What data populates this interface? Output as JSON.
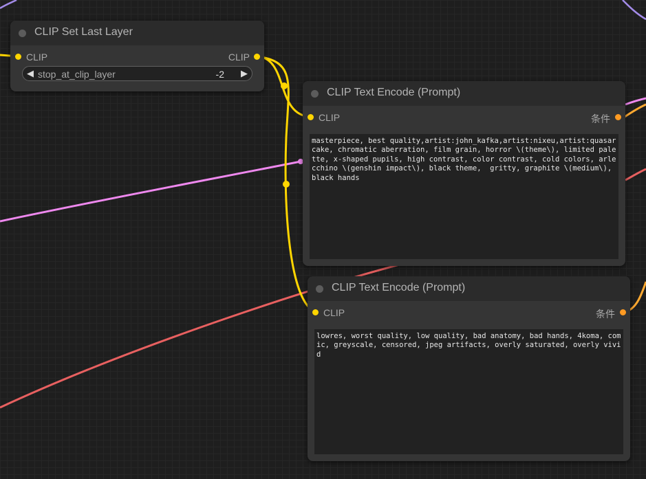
{
  "colors": {
    "clip_link": "#ffd500",
    "conditioning_link": "#ffa931",
    "pink_link": "#ee88ee",
    "red_link": "#e86060",
    "purple_link": "#a38be8"
  },
  "nodes": {
    "clip_set_last_layer": {
      "title": "CLIP Set Last Layer",
      "input_label": "CLIP",
      "output_label": "CLIP",
      "widget": {
        "left_arrow": "◀",
        "name": "stop_at_clip_layer",
        "value": "-2",
        "right_arrow": "▶"
      }
    },
    "clip_text_encode_positive": {
      "title": "CLIP Text Encode (Prompt)",
      "input_label": "CLIP",
      "output_label": "条件",
      "text": "masterpiece, best quality,artist:john_kafka,artist:nixeu,artist:quasarcake, chromatic aberration, film grain, horror \\(theme\\), limited palette, x-shaped pupils, high contrast, color contrast, cold colors, arlecchino \\(genshin impact\\), black theme,  gritty, graphite \\(medium\\), black hands"
    },
    "clip_text_encode_negative": {
      "title": "CLIP Text Encode (Prompt)",
      "input_label": "CLIP",
      "output_label": "条件",
      "text": "lowres, worst quality, low quality, bad anatomy, bad hands, 4koma, comic, greyscale, censored, jpeg artifacts, overly saturated, overly vivid"
    }
  }
}
